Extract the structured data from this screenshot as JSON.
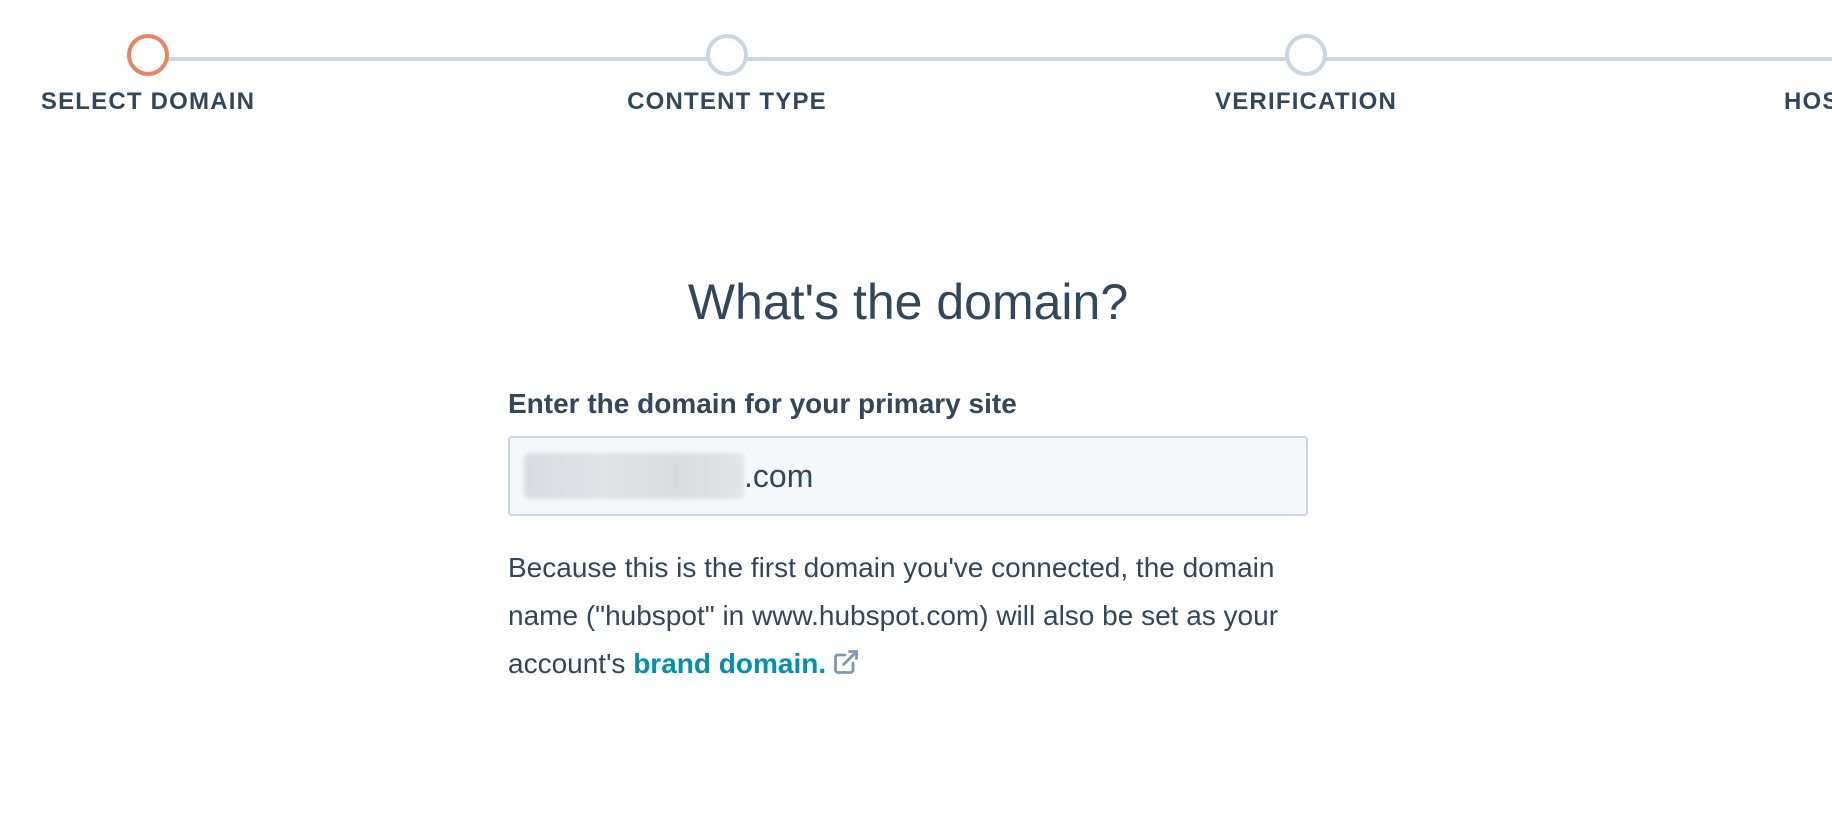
{
  "stepper": {
    "steps": [
      {
        "label": "SELECT DOMAIN",
        "state": "active"
      },
      {
        "label": "CONTENT TYPE",
        "state": "pending"
      },
      {
        "label": "VERIFICATION",
        "state": "pending"
      },
      {
        "label": "HOS",
        "state": "pending"
      }
    ]
  },
  "main": {
    "heading": "What's the domain?",
    "field_label": "Enter the domain for your primary site",
    "input_suffix": ".com",
    "help_text_part1": "Because this is the first domain you've connected, the domain name (\"hubspot\" in www.hubspot.com) will also be set as your account's ",
    "brand_link_text": "brand domain."
  },
  "colors": {
    "active_step": "#ea8363",
    "inactive_step": "#cbd6e2",
    "link": "#0091ae",
    "text": "#33475b"
  },
  "icons": {
    "external_link": "external-link-icon"
  }
}
